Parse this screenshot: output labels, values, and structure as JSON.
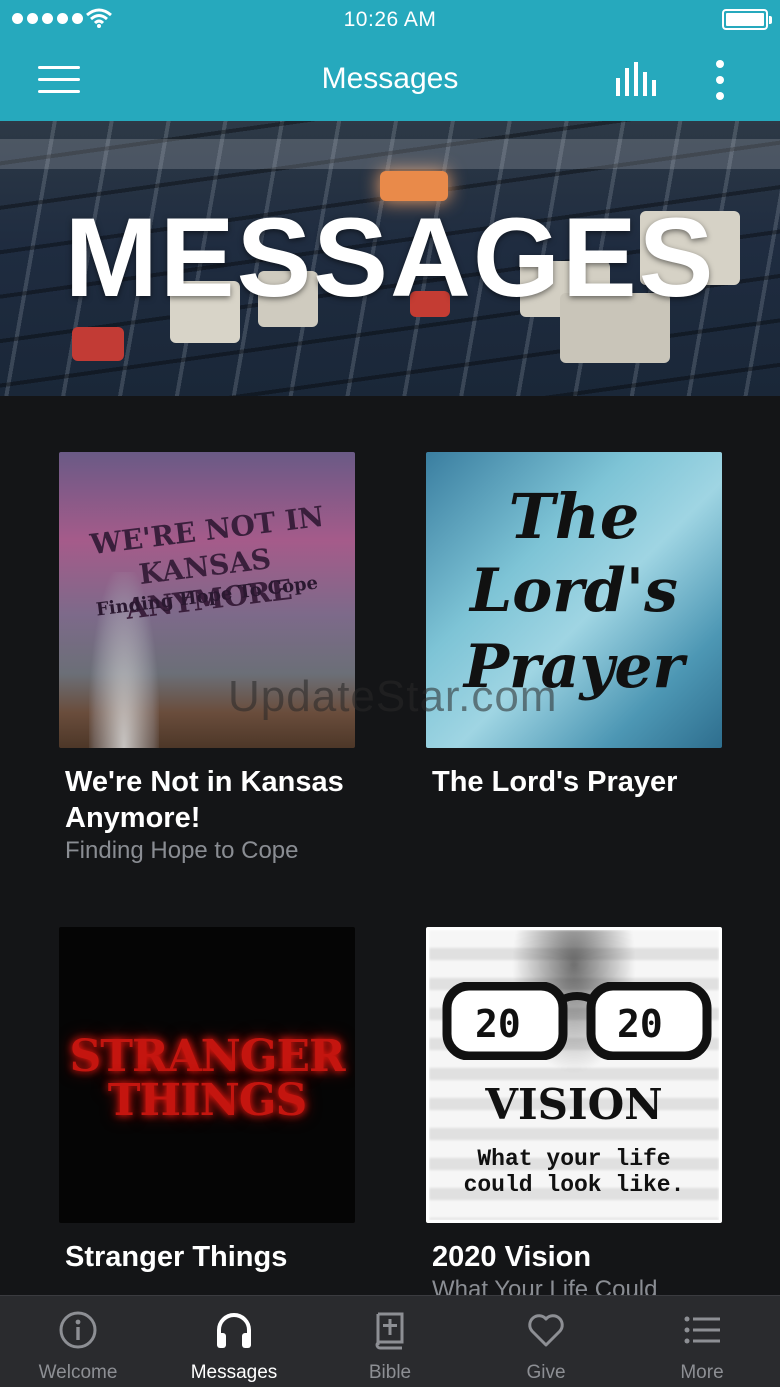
{
  "status_bar": {
    "time": "10:26 AM"
  },
  "nav": {
    "title": "Messages",
    "menu_icon": "hamburger-icon",
    "equalizer_icon": "equalizer-icon",
    "more_icon": "vertical-dots-icon"
  },
  "hero": {
    "title": "MESSAGES"
  },
  "series": [
    {
      "title": "We're Not in Kansas Anymore!",
      "subtitle": "Finding Hope to Cope",
      "artwork_text": [
        "WE'RE NOT IN",
        "KANSAS ANYMORE",
        "Finding Hope To Cope"
      ]
    },
    {
      "title": "The Lord's Prayer",
      "subtitle": "",
      "artwork_text": [
        "The",
        "Lord's",
        "Prayer"
      ]
    },
    {
      "title": "Stranger Things",
      "subtitle": "",
      "artwork_text": [
        "STRANGER",
        "THINGS"
      ]
    },
    {
      "title": "2020 Vision",
      "subtitle": "What Your Life Could",
      "artwork_text": [
        "20",
        "20",
        "VISION",
        "What your life",
        "could look like."
      ]
    }
  ],
  "watermark": "UpdateStar.com",
  "tabs": [
    {
      "label": "Welcome",
      "icon": "info-icon",
      "active": false
    },
    {
      "label": "Messages",
      "icon": "headphones-icon",
      "active": true
    },
    {
      "label": "Bible",
      "icon": "bible-icon",
      "active": false
    },
    {
      "label": "Give",
      "icon": "heart-icon",
      "active": false
    },
    {
      "label": "More",
      "icon": "list-icon",
      "active": false
    }
  ],
  "colors": {
    "accent": "#26a9bd",
    "background": "#141517",
    "tab_bar": "#2a2b2e",
    "muted_text": "#8a8d93"
  }
}
